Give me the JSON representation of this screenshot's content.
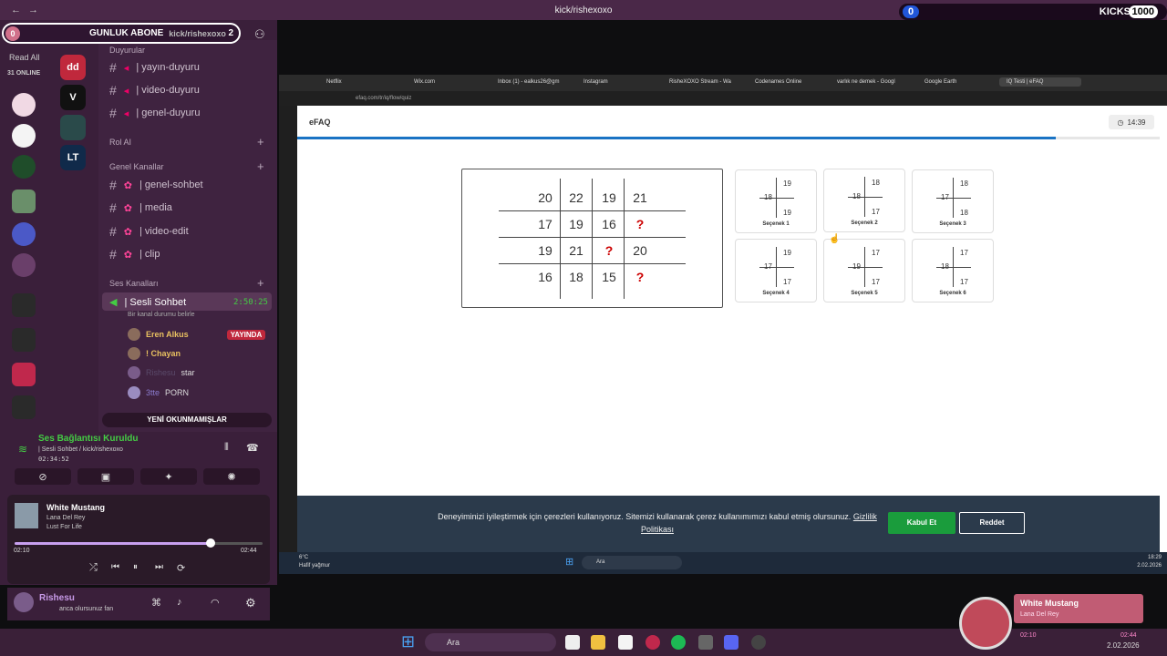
{
  "window": {
    "title": "kick/rishexoxo",
    "nav_back": "←",
    "nav_fwd": "→"
  },
  "kicks": {
    "badge": "0",
    "label": "KICKS",
    "count": "1000"
  },
  "goal_bar": {
    "zero": "0",
    "title": "GUNLUK ABONE",
    "channel": "kick/rishexoxo",
    "count": "2"
  },
  "left": {
    "read_all": "Read All",
    "online": "31 ONLINE"
  },
  "channels": {
    "section_top": "Duyurular",
    "items_top": [
      "| yayın-duyuru",
      "| video-duyuru",
      "| genel-duyuru"
    ],
    "rol_ai": "Rol AI",
    "genel_kanallar": "Genel Kanallar",
    "items_genel": [
      "| genel-sohbet",
      "| media",
      "| video-edit",
      "| clip"
    ],
    "ses_kanallari": "Ses Kanalları",
    "voice_channel": "| Sesli Sohbet",
    "voice_timer": "2:50:25",
    "status_hint": "Bir kanal durumu belirle",
    "users": [
      {
        "name": "Eren Alkus",
        "badge": "YAYINDA"
      },
      {
        "name": "! Chayan",
        "badge": ""
      },
      {
        "name": "Rishesu",
        "badge": "star"
      },
      {
        "name": "3tte",
        "badge": "PORN"
      }
    ],
    "unread": "YENİ OKUNMAMIŞLAR"
  },
  "connection": {
    "title": "Ses Bağlantısı Kuruldu",
    "sub": "| Sesli Sohbet / kick/rishexoxo",
    "timer": "02:34:52"
  },
  "player": {
    "title": "White Mustang",
    "artist": "Lana Del Rey",
    "album": "Lust For Life",
    "elapsed": "02:10",
    "total": "02:44",
    "progress": 0.79
  },
  "user": {
    "name": "Rishesu",
    "status": "anca olursunuz fan"
  },
  "browser": {
    "tabs": [
      "Netflix",
      "Wix.com",
      "Inbox (1) - ealkus26@gm",
      "Instagram",
      "RisheXOXO Stream - Wa",
      "Codenames Online",
      "varlık ne demek - Googl",
      "Google Earth",
      "IQ Testi | eFAQ"
    ],
    "url": "efaq.com/tr/iq/flow/quiz"
  },
  "efaq": {
    "title": "eFAQ",
    "timer": "14:39",
    "progress": 0.88
  },
  "puzzle": {
    "rows": [
      [
        "20",
        "22",
        "19",
        "21"
      ],
      [
        "17",
        "19",
        "16",
        "?"
      ],
      [
        "19",
        "21",
        "?",
        "20"
      ],
      [
        "16",
        "18",
        "15",
        "?"
      ]
    ]
  },
  "options": [
    {
      "top": "19",
      "left": "18",
      "bottom": "19",
      "label": "Seçenek 1"
    },
    {
      "top": "18",
      "left": "18",
      "bottom": "17",
      "label": "Seçenek 2"
    },
    {
      "top": "18",
      "left": "17",
      "bottom": "18",
      "label": "Seçenek 3"
    },
    {
      "top": "19",
      "left": "17",
      "bottom": "17",
      "label": "Seçenek 4"
    },
    {
      "top": "17",
      "left": "19",
      "bottom": "17",
      "label": "Seçenek 5"
    },
    {
      "top": "17",
      "left": "18",
      "bottom": "17",
      "label": "Seçenek 6"
    }
  ],
  "cookie": {
    "text": "Deneyiminizi iyileştirmek için çerezleri kullanıyoruz. Sitemizi kullanarak çerez kullanımımızı kabul etmiş olursunuz.",
    "link": "Gizlilik Politikası",
    "accept": "Kabul Et",
    "reject": "Reddet"
  },
  "win_taskbar": {
    "weather_temp": "6°C",
    "weather_desc": "Hafif yağmur",
    "search": "Ara",
    "time": "18:29",
    "date": "2.02.2026"
  },
  "host_taskbar": {
    "search": "Ara",
    "date": "2.02.2026"
  },
  "now_playing": {
    "title": "White Mustang",
    "artist": "Lana Del Rey",
    "elapsed": "02:10",
    "total": "02:44"
  },
  "colors": {
    "accent_green": "#1a9c3c",
    "progress_blue": "#1a73c4",
    "question_red": "#cc0000"
  }
}
